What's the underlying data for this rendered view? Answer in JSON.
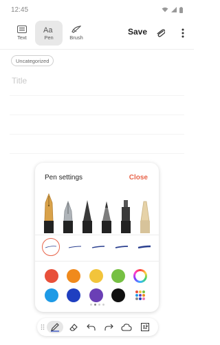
{
  "status_bar": {
    "time": "12:45"
  },
  "toolbar": {
    "modes": [
      {
        "label": "Text",
        "icon": "keyboard-icon"
      },
      {
        "label": "Pen",
        "icon": "pen-text-icon",
        "active": true
      },
      {
        "label": "Brush",
        "icon": "brush-icon"
      }
    ],
    "save_label": "Save"
  },
  "note": {
    "category": "Uncategorized",
    "title_placeholder": "Title"
  },
  "pen_settings": {
    "title": "Pen settings",
    "close_label": "Close",
    "pens": [
      "fountain-pen",
      "calligraphy-pen",
      "pen",
      "pencil",
      "marker",
      "highlighter"
    ],
    "selected_stroke": 0,
    "colors": [
      "#e8503a",
      "#f08a1c",
      "#f2c43b",
      "#76c043",
      "rainbow",
      "#1e9ae6",
      "#1f3fc0",
      "#6a3fb5",
      "#111111",
      "palette"
    ],
    "selected_color": "#1f3fc0",
    "page_count": 4,
    "current_page": 1
  },
  "bottom_toolbar": {
    "tools": [
      "grip-icon",
      "pen-tool-icon",
      "eraser-icon",
      "undo-icon",
      "redo-icon",
      "shape-icon",
      "insert-icon"
    ]
  }
}
